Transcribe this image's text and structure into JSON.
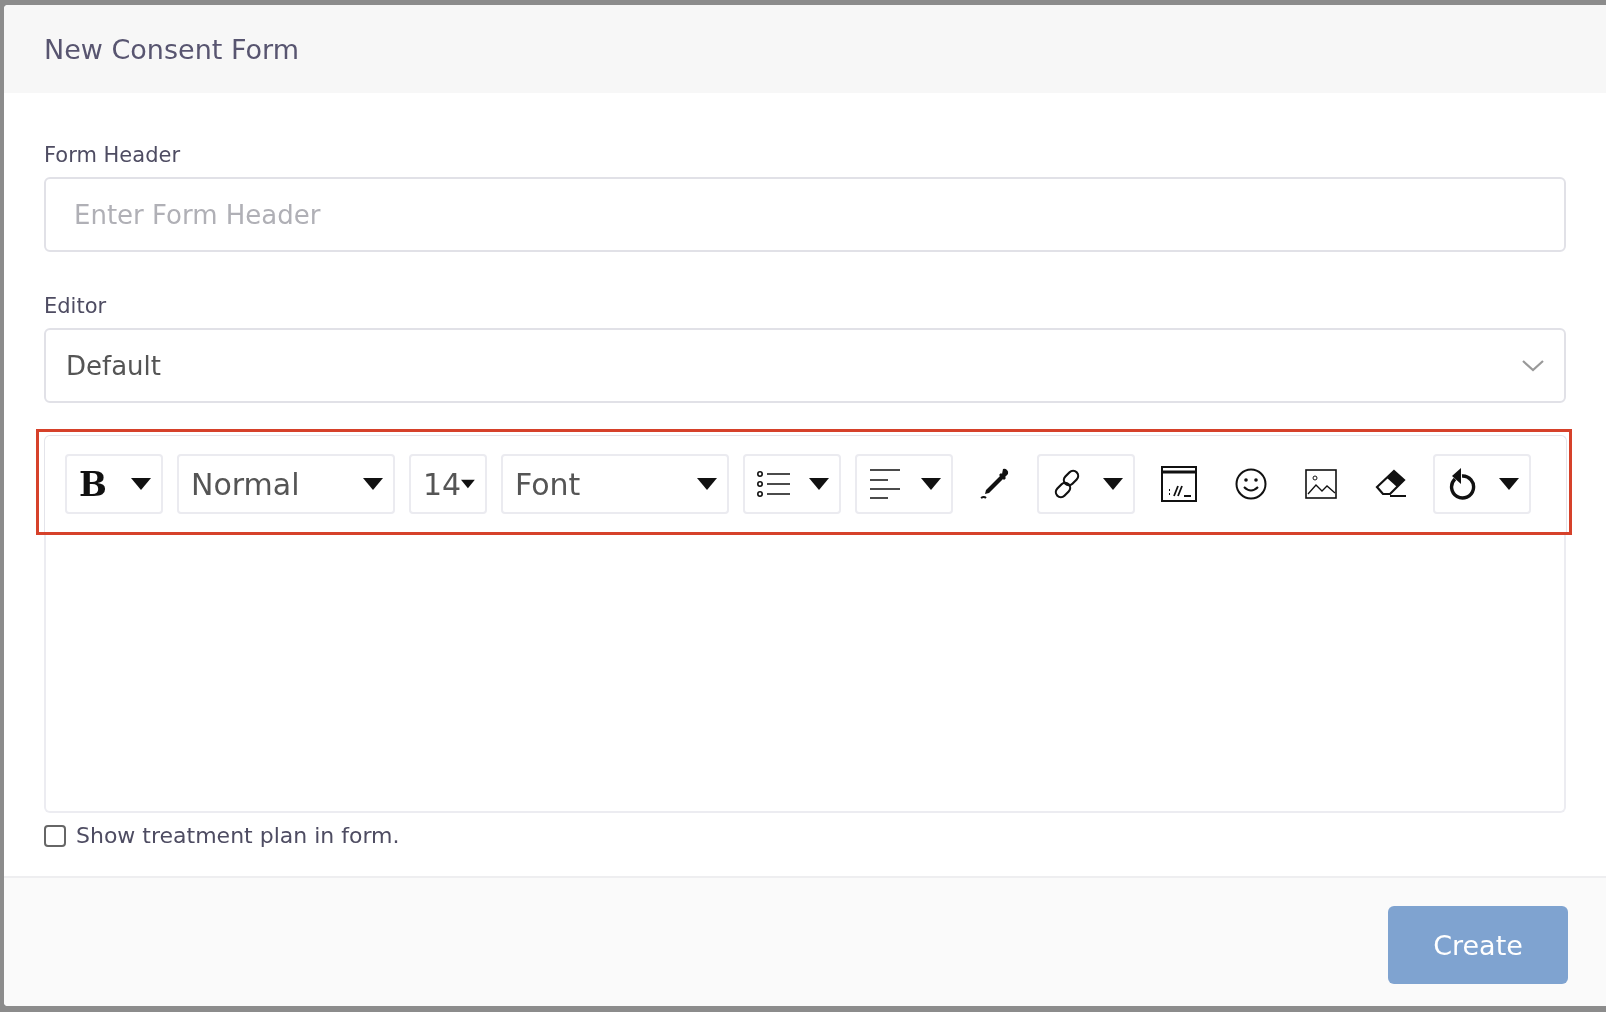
{
  "dialog": {
    "title": "New Consent Form"
  },
  "fields": [
    {
      "kind": "text",
      "label": "Form Header",
      "placeholder": "Enter Form Header"
    },
    {
      "kind": "select",
      "label": "Editor",
      "value": "Default"
    }
  ],
  "toolbar": [
    {
      "kind": "icon-dropdown",
      "label": "B"
    },
    {
      "kind": "dropdown",
      "label": "Normal"
    },
    {
      "kind": "dropdown",
      "label": "14"
    },
    {
      "kind": "dropdown",
      "label": "Font"
    },
    {
      "kind": "icon-dropdown"
    },
    {
      "kind": "icon-dropdown"
    },
    {
      "kind": "icon"
    },
    {
      "kind": "icon-dropdown"
    },
    {
      "kind": "icon"
    },
    {
      "kind": "icon"
    },
    {
      "kind": "icon"
    },
    {
      "kind": "icon"
    },
    {
      "kind": "icon-dropdown"
    }
  ],
  "checkbox": {
    "label": "Show treatment plan in form.",
    "checked": false
  },
  "buttons": [
    {
      "label": "Create",
      "disabled": true
    }
  ]
}
